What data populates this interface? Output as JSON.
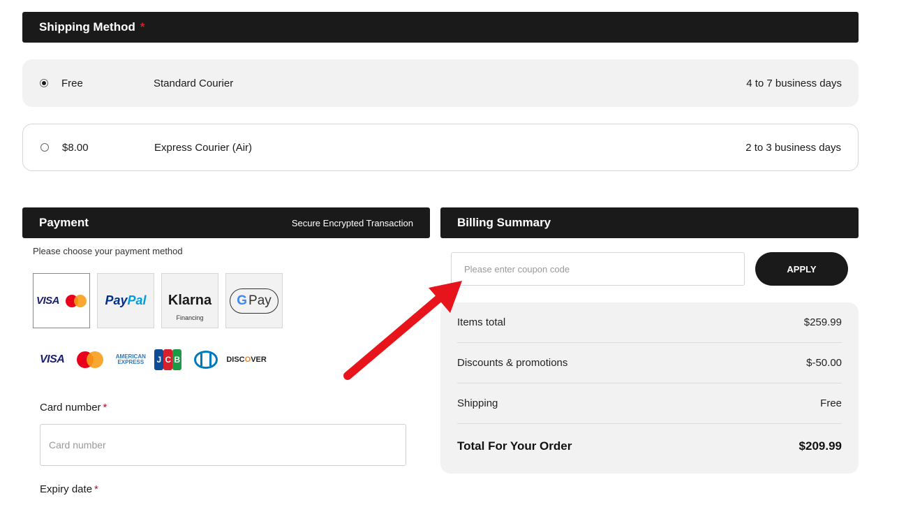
{
  "shipping": {
    "title": "Shipping Method",
    "required_mark": "*",
    "options": [
      {
        "price": "Free",
        "name": "Standard Courier",
        "days": "4 to 7 business days",
        "selected": true
      },
      {
        "price": "$8.00",
        "name": "Express Courier (Air)",
        "days": "2 to 3 business days",
        "selected": false
      }
    ]
  },
  "payment": {
    "title": "Payment",
    "secure_text": "Secure Encrypted Transaction",
    "hint": "Please choose your payment method",
    "methods": {
      "card": {
        "visa": "VISA",
        "selected": true
      },
      "paypal": {
        "pay": "Pay",
        "pal": "Pal"
      },
      "klarna": {
        "name": "Klarna",
        "sub": "Financing"
      },
      "gpay": {
        "g": "G",
        "pay": "Pay"
      }
    },
    "card_logos": {
      "visa": "VISA",
      "amex_line1": "AMERICAN",
      "amex_line2": "EXPRESS",
      "jcb": [
        "J",
        "C",
        "B"
      ],
      "discover_a": "DISC",
      "discover_o": "O",
      "discover_b": "VER"
    },
    "card_number_label": "Card number",
    "card_number_placeholder": "Card number",
    "expiry_label": "Expiry date",
    "required_mark": "*"
  },
  "billing": {
    "title": "Billing Summary",
    "coupon_placeholder": "Please enter coupon code",
    "apply_label": "APPLY",
    "rows": [
      {
        "label": "Items total",
        "value": "$259.99"
      },
      {
        "label": "Discounts & promotions",
        "value": "$-50.00"
      },
      {
        "label": "Shipping",
        "value": "Free"
      }
    ],
    "total": {
      "label": "Total For Your Order",
      "value": "$209.99"
    }
  },
  "colors": {
    "accent_dark": "#1a1a1a",
    "required": "#d62020",
    "annotation_arrow": "#e8141b"
  }
}
